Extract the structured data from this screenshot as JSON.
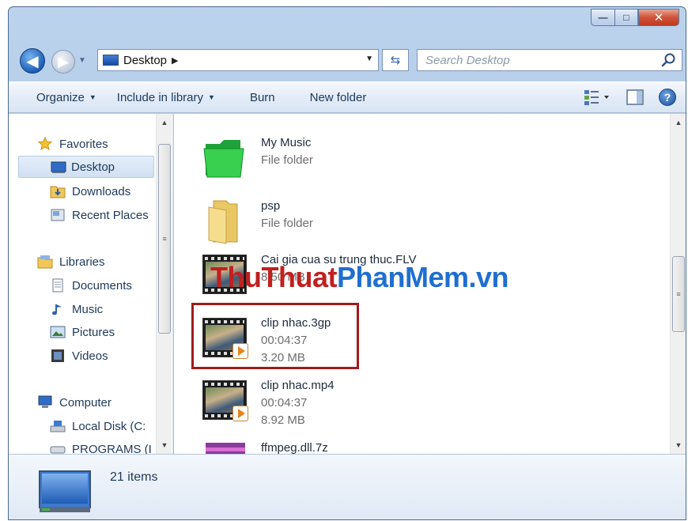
{
  "window": {
    "controls": {
      "minimize": "—",
      "maximize": "□",
      "close": "✕"
    }
  },
  "address": {
    "location": "Desktop",
    "search_placeholder": "Search Desktop"
  },
  "toolbar": {
    "organize": "Organize",
    "include_in_library": "Include in library",
    "burn": "Burn",
    "new_folder": "New folder"
  },
  "nav": {
    "favorites": {
      "label": "Favorites",
      "items": [
        "Desktop",
        "Downloads",
        "Recent Places"
      ]
    },
    "libraries": {
      "label": "Libraries",
      "items": [
        "Documents",
        "Music",
        "Pictures",
        "Videos"
      ]
    },
    "computer": {
      "label": "Computer",
      "items": [
        "Local Disk (C:",
        "PROGRAMS (I"
      ]
    }
  },
  "files": [
    {
      "name": "My Music",
      "line2": "File folder",
      "line3": ""
    },
    {
      "name": "psp",
      "line2": "File folder",
      "line3": ""
    },
    {
      "name": "Cai gia cua su trung thuc.FLV",
      "line2": "",
      "line3": "8.50 MB"
    },
    {
      "name": "clip nhac.3gp",
      "line2": "00:04:37",
      "line3": "3.20 MB"
    },
    {
      "name": "clip nhac.mp4",
      "line2": "00:04:37",
      "line3": "8.92 MB"
    },
    {
      "name": "ffmpeg.dll.7z",
      "line2": "",
      "line3": ""
    }
  ],
  "watermark": {
    "part1": "ThuThuat",
    "part2": "PhanMem.vn"
  },
  "status": {
    "item_count": "21 items"
  },
  "colors": {
    "accent": "#1e395b",
    "highlight": "#9e1c1c",
    "watermark_red": "#c0201f",
    "watermark_blue": "#1f6fd0"
  }
}
